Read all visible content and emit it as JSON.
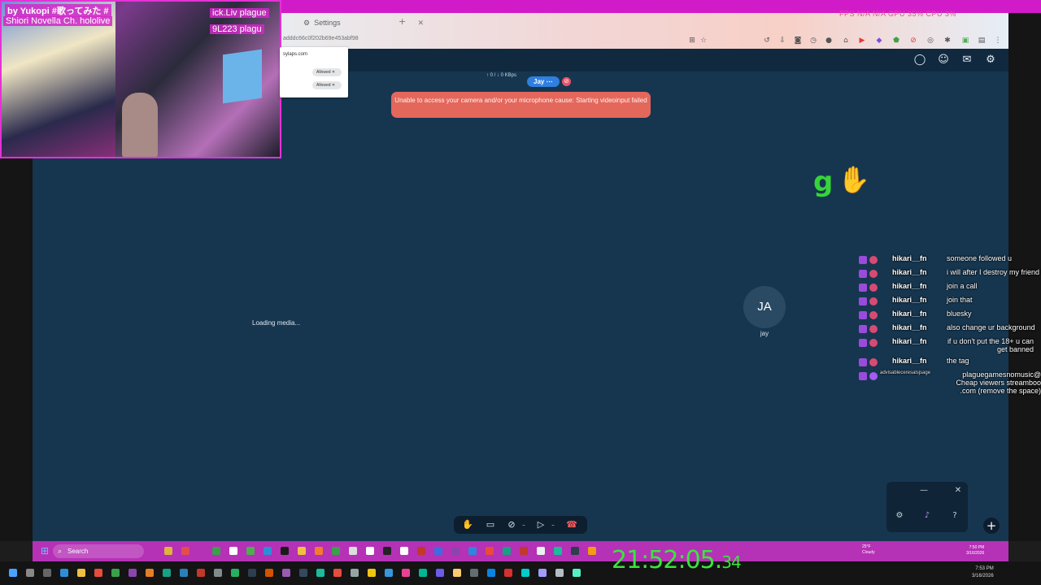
{
  "browser": {
    "tab_title": "Settings",
    "url": "adddc66c0f202b69e453abf98",
    "overlay_stats": "FPS N/A  N/A  GPU 35%  CPU 3%"
  },
  "permission_popup": {
    "site": "sylaps.com",
    "camera_status": "Allowed",
    "mic_status": "Allowed"
  },
  "webcam": {
    "title_line1": "by Yukopi #歌ってみた #",
    "title_line2": "Shiori Novella Ch. hololive",
    "tag_line1": "ick.Liv plague",
    "tag_line2": "9L223 plagu"
  },
  "call": {
    "bitrate": "↑ 0 / ↓ 0 KBps",
    "participant_pill": "Jay  ⋯",
    "error_message": "Unable to access your camera and/or your microphone cause: Starting videoinput failed",
    "loading_text": "Loading media...",
    "avatar_initials": "JA",
    "avatar_name": "jay"
  },
  "overlay_text": {
    "big_letter": "g"
  },
  "chat": [
    {
      "user": "hikari__fn",
      "message": "someone followed u"
    },
    {
      "user": "hikari__fn",
      "message": "i will after I destroy my friend"
    },
    {
      "user": "hikari__fn",
      "message": "join a call"
    },
    {
      "user": "hikari__fn",
      "message": "join that"
    },
    {
      "user": "hikari__fn",
      "message": "bluesky"
    },
    {
      "user": "hikari__fn",
      "message": "also change ur background"
    },
    {
      "user": "hikari__fn",
      "message": "if u don't put the 18+ u can get banned"
    },
    {
      "user": "hikari__fn",
      "message": "the tag"
    },
    {
      "user": "advisableceresalsjsage",
      "message": "plaguegamesnomusic@ Cheap viewers streamboo .com (remove the space)"
    }
  ],
  "taskbar": {
    "search_placeholder": "Search",
    "weather_temp": "25°F",
    "weather_desc": "Cloudy",
    "time": "7:50 PM",
    "date": "3/16/2026"
  },
  "bottom_tray": {
    "time": "7:53 PM",
    "date": "3/16/2026"
  },
  "clock_overlay": {
    "main": "21:52:05.",
    "fraction": "34"
  }
}
